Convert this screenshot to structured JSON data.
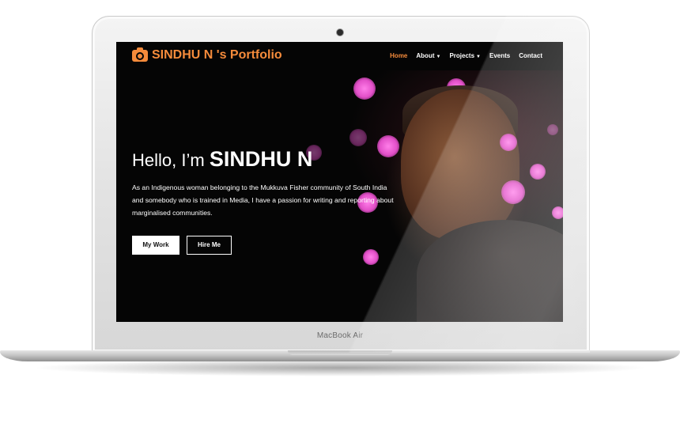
{
  "device": {
    "model_label": "MacBook Air"
  },
  "navbar": {
    "brand": "SINDHU N 's Portfolio",
    "brand_icon": "camera-icon",
    "brand_color": "#f58b3b",
    "items": [
      {
        "label": "Home",
        "active": true,
        "dropdown": false
      },
      {
        "label": "About",
        "active": false,
        "dropdown": true
      },
      {
        "label": "Projects",
        "active": false,
        "dropdown": true
      },
      {
        "label": "Events",
        "active": false,
        "dropdown": false
      },
      {
        "label": "Contact",
        "active": false,
        "dropdown": false
      }
    ]
  },
  "hero": {
    "greeting_prefix": "Hello, I’m",
    "name": "SINDHU N",
    "intro": "As an Indigenous woman belonging to the Mukkuva Fisher community of South India and somebody who is trained in Media, I have a passion for writing and reporting about marginalised communities.",
    "buttons": {
      "primary": "My Work",
      "secondary": "Hire Me"
    }
  }
}
